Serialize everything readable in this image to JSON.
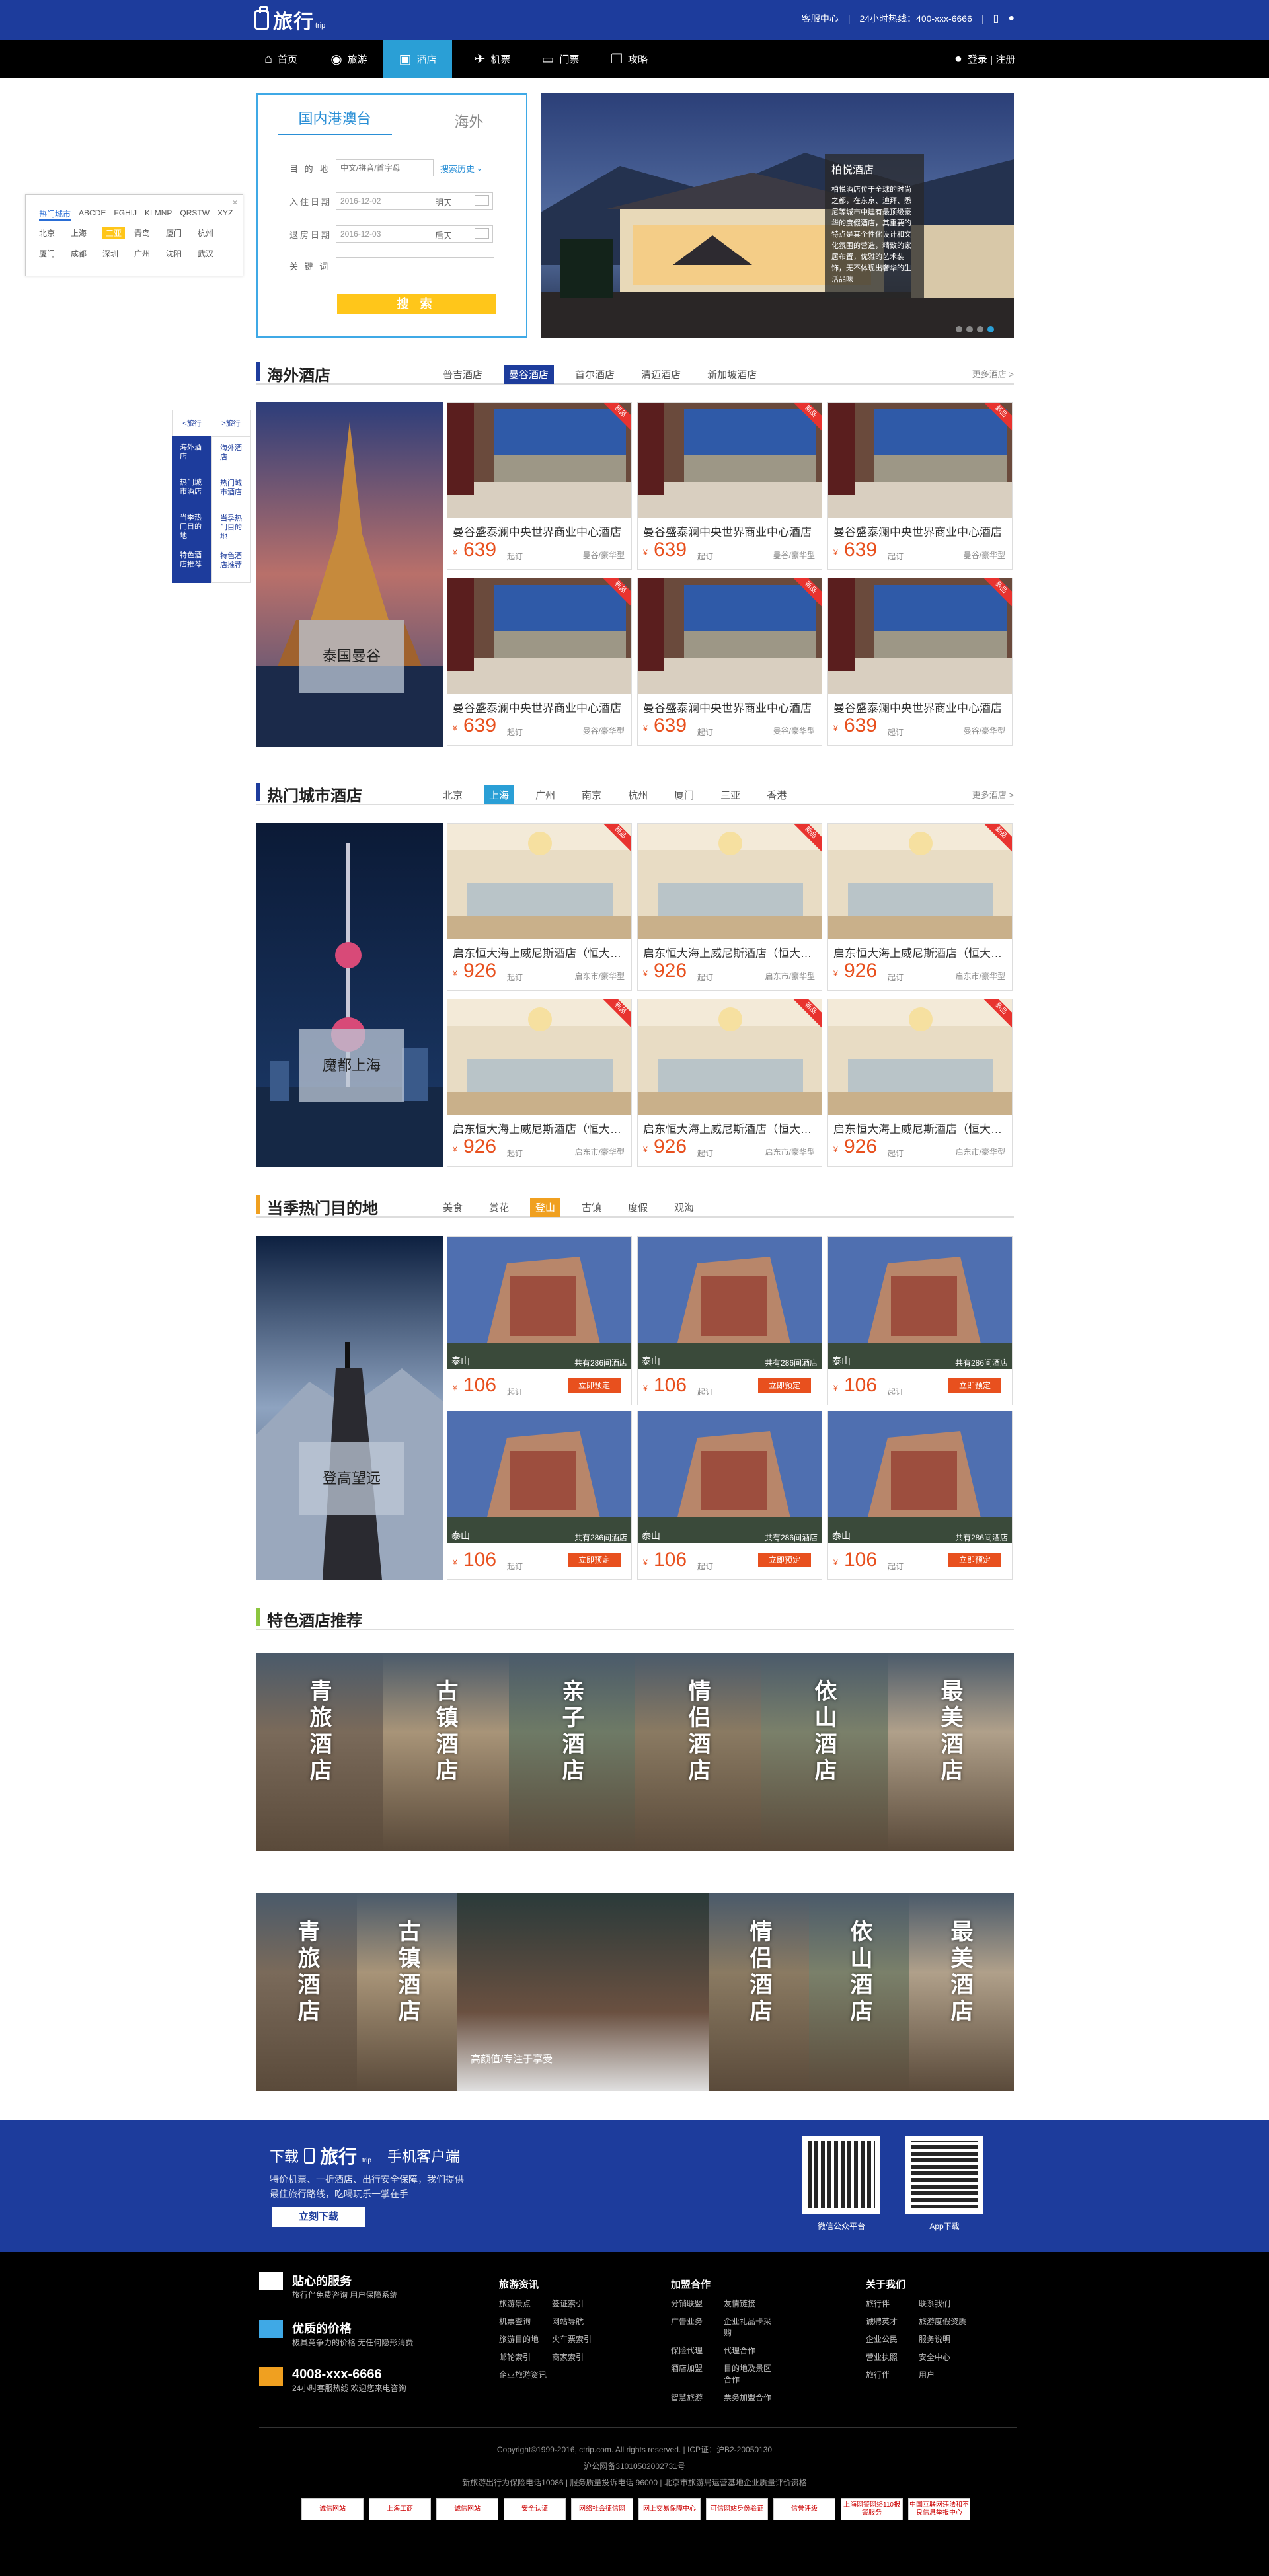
{
  "header": {
    "logo_text": "旅行",
    "logo_sub": "trip",
    "service_center": "客服中心",
    "hotline": "24小时热线：400-xxx-6666",
    "phone_icon": "phone-icon",
    "wechat_icon": "wechat-icon"
  },
  "nav": {
    "items": [
      {
        "label": "首页",
        "icon": "home-icon"
      },
      {
        "label": "旅游",
        "icon": "globe-icon"
      },
      {
        "label": "酒店",
        "icon": "hotel-icon"
      },
      {
        "label": "机票",
        "icon": "plane-icon"
      },
      {
        "label": "门票",
        "icon": "ticket-icon"
      },
      {
        "label": "攻略",
        "icon": "book-icon"
      }
    ],
    "login": "登录 | 注册"
  },
  "search": {
    "tabs": [
      "国内港澳台",
      "海外"
    ],
    "dest_label": "目 的 地",
    "dest_placeholder": "中文/拼音/首字母",
    "history": "搜索历史",
    "checkin_label": "入住日期",
    "checkin": "2016-12-02",
    "checkin_day": "明天",
    "checkout_label": "退房日期",
    "checkout": "2016-12-03",
    "checkout_day": "后天",
    "keyword_label": "关 键 词",
    "button": "搜 索"
  },
  "city_popup": {
    "tabs": [
      "热门城市",
      "ABCDE",
      "FGHIJ",
      "KLMNP",
      "QRSTW",
      "XYZ"
    ],
    "cities": [
      "北京",
      "上海",
      "三亚",
      "青岛",
      "厦门",
      "杭州",
      "厦门",
      "成都",
      "深圳",
      "广州",
      "沈阳",
      "武汉"
    ],
    "close": "×"
  },
  "hero": {
    "title": "柏悦酒店",
    "desc": "柏悦酒店位于全球的时尚之都，在东京、迪拜、悉尼等城市中建有最顶级豪华的度假酒店，其重要的特点是其个性化设计和文化氛围的营造，精致的家居布置，优雅的艺术装饰，无不体现出奢华的生活品味"
  },
  "sidenav": {
    "top": [
      "<旅行",
      ">旅行"
    ],
    "items": [
      [
        "海外酒店",
        "海外酒店"
      ],
      [
        "热门城市酒店",
        "热门城市酒店"
      ],
      [
        "当季热门目的地",
        "当季热门目的地"
      ],
      [
        "特色酒店推荐",
        "特色酒店推荐"
      ]
    ]
  },
  "sec1": {
    "title": "海外酒店",
    "tabs": [
      "普吉酒店",
      "曼谷酒店",
      "首尔酒店",
      "清迈酒店",
      "新加坡酒店"
    ],
    "active": 1,
    "more": "更多酒店 >",
    "left_label": "泰国曼谷",
    "card": {
      "name": "曼谷盛泰澜中央世界商业中心酒店",
      "cur": "¥",
      "price": "639",
      "qi": "起订",
      "type": "曼谷/豪华型",
      "badge": "新品"
    }
  },
  "sec2": {
    "title": "热门城市酒店",
    "tabs": [
      "北京",
      "上海",
      "广州",
      "南京",
      "杭州",
      "厦门",
      "三亚",
      "香港"
    ],
    "active": 1,
    "more": "更多酒店 >",
    "left_label": "魔都上海",
    "card": {
      "name": "启东恒大海上威尼斯酒店（恒大海上威尼斯）",
      "cur": "¥",
      "price": "926",
      "qi": "起订",
      "type": "启东市/豪华型",
      "badge": "新品"
    }
  },
  "sec3": {
    "title": "当季热门目的地",
    "tabs": [
      "美食",
      "赏花",
      "登山",
      "古镇",
      "度假",
      "观海"
    ],
    "active": 2,
    "left_label": "登高望远",
    "card": {
      "city": "泰山",
      "count": "共有286间酒店",
      "cur": "¥",
      "price": "106",
      "qi": "起订",
      "book": "立即预定"
    }
  },
  "sec4": {
    "title": "特色酒店推荐",
    "row1": [
      "青旅酒店",
      "古镇酒店",
      "亲子酒店",
      "情侣酒店",
      "依山酒店",
      "最美酒店"
    ],
    "row2": [
      "青旅酒店",
      "古镇酒店",
      "情侣酒店",
      "依山酒店",
      "最美酒店"
    ],
    "center_caption": "高颜值/专注于享受"
  },
  "download": {
    "title1": "下载",
    "title2": "手机客户端",
    "line1": "特价机票、一折酒店、出行安全保障，我们提供",
    "line2": "最佳旅行路线，吃喝玩乐一掌在手",
    "button": "立刻下载",
    "qr1": "微信公众平台",
    "qr2": "App下载"
  },
  "footer": {
    "service": {
      "title": "贴心的服务",
      "text": "旅行伴免费咨询 用户保障系统"
    },
    "price": {
      "title": "优质的价格",
      "text": "极具竞争力的价格 无任何隐形消费"
    },
    "phone": {
      "title": "4008-xxx-6666",
      "text": "24小时客服热线 欢迎您来电咨询"
    },
    "cols": [
      {
        "title": "旅游资讯",
        "links": [
          "旅游景点",
          "签证索引",
          "机票查询",
          "网站导航",
          "旅游目的地",
          "火车票索引",
          "邮轮索引",
          "商家索引",
          "企业旅游资讯"
        ]
      },
      {
        "title": "加盟合作",
        "links": [
          "分销联盟",
          "友情链接",
          "广告业务",
          "企业礼品卡采购",
          "保险代理",
          "代理合作",
          "酒店加盟",
          "目的地及景区合作",
          "智慧旅游",
          "票务加盟合作"
        ]
      },
      {
        "title": "关于我们",
        "links": [
          "旅行伴",
          "联系我们",
          "诚聘英才",
          "旅游度假资质",
          "企业公民",
          "服务说明",
          "营业执照",
          "安全中心",
          "旅行伴",
          "用户"
        ]
      }
    ],
    "copy1": "Copyright©1999-2016, ctrip.com. All rights reserved. | ICP证：沪B2-20050130",
    "copy2": "沪公网备31010502002731号",
    "copy3": "新旅游出行为保险电话10086 | 服务质量投诉电话 96000 | 北京市旅游局运营基地企业质量评价资格",
    "badges": [
      "诚信网站",
      "上海工商",
      "诚信网站",
      "安全认证",
      "网络社会征信网",
      "网上交易保障中心",
      "可信网站身份验证",
      "信誉评级",
      "上海网警网络110报警服务",
      "中国互联网违法和不良信息举报中心"
    ]
  },
  "colors": {
    "brand_blue": "#1d3c9c",
    "accent_blue": "#2a9fd6",
    "price": "#e8501e",
    "yellow": "#ffc61a"
  }
}
